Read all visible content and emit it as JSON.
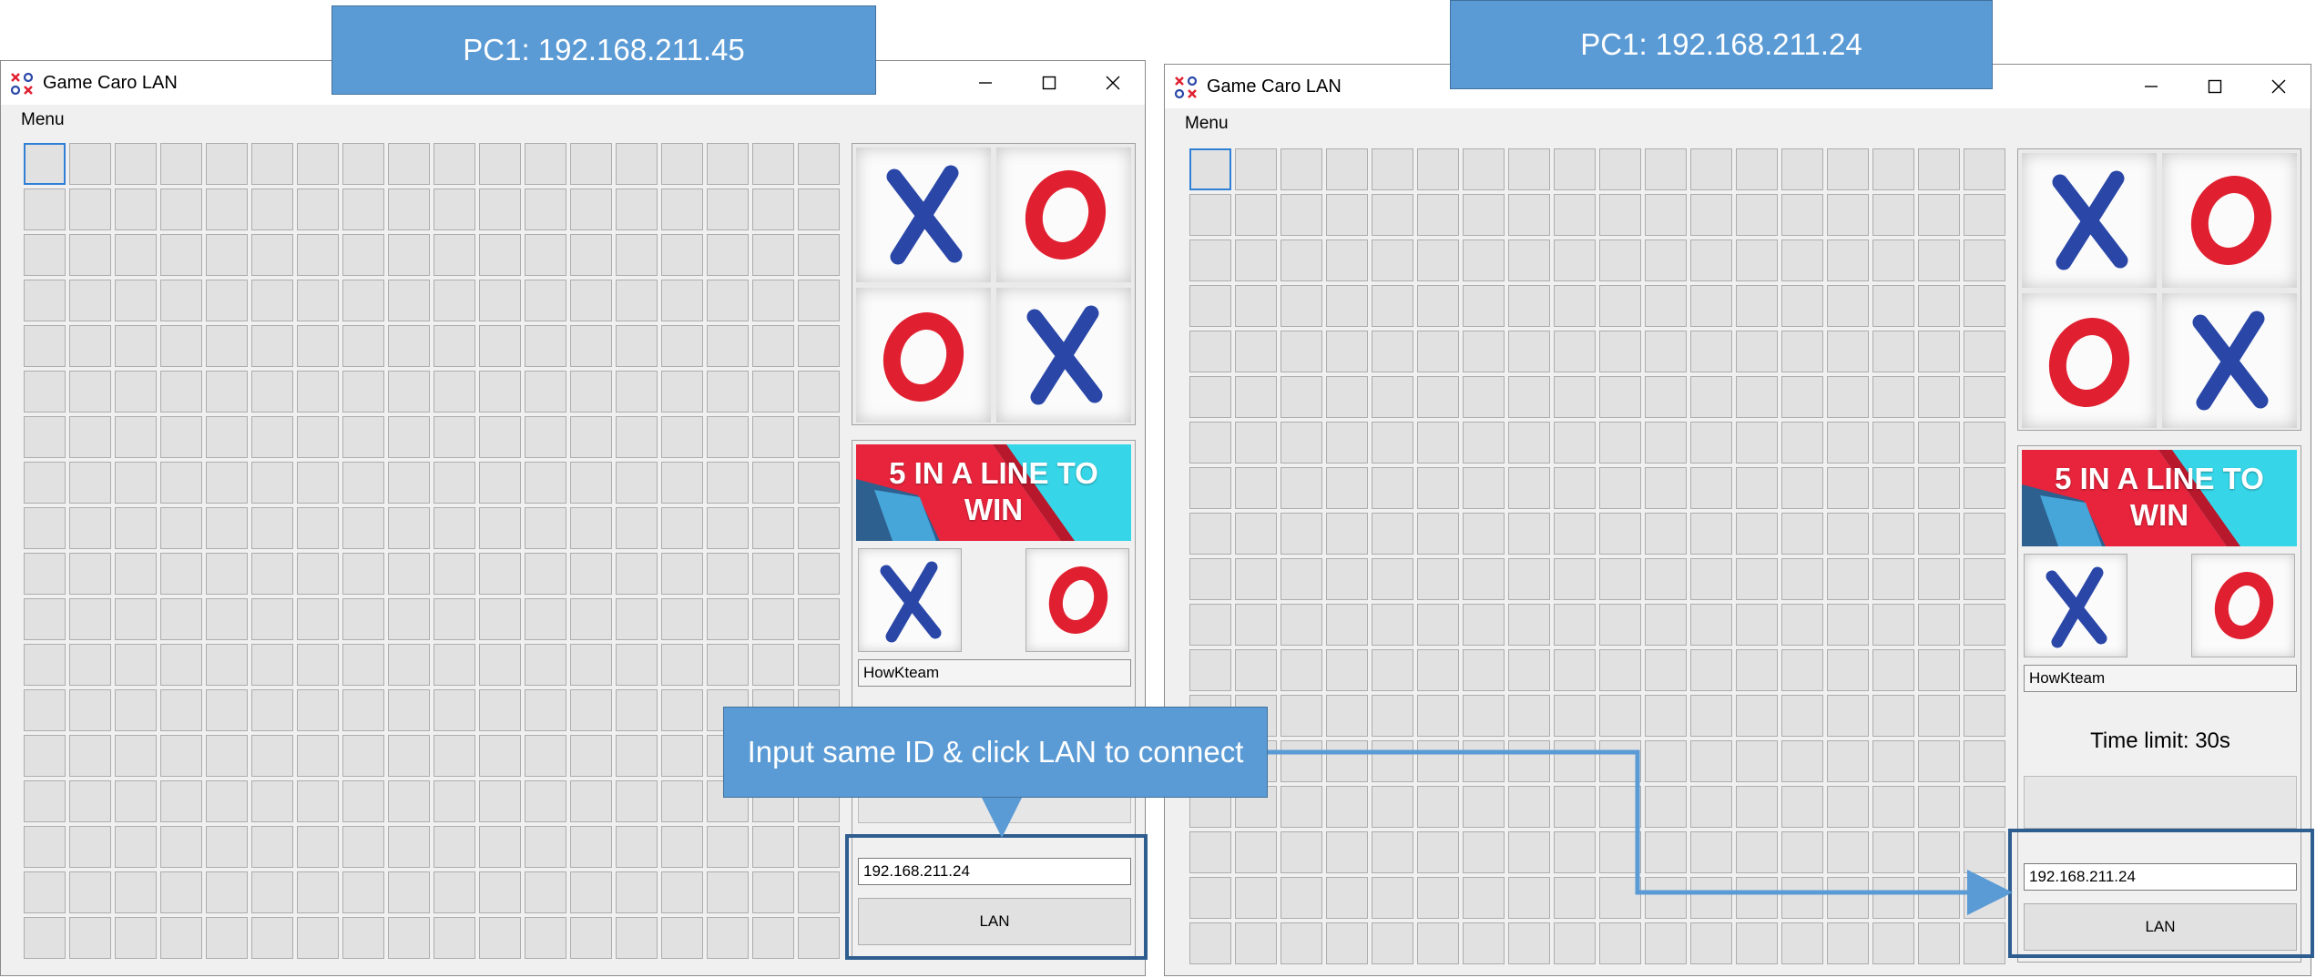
{
  "windows": [
    {
      "title": "Game Caro LAN",
      "menu": "Menu",
      "banner_text": "5 IN A LINE TO WIN",
      "player_name": "HowKteam",
      "timer_label": "",
      "ip_value": "192.168.211.24",
      "lan_label": "LAN"
    },
    {
      "title": "Game Caro LAN",
      "menu": "Menu",
      "banner_text": "5 IN A LINE TO WIN",
      "player_name": "HowKteam",
      "timer_label": "Time limit: 30s",
      "ip_value": "192.168.211.24",
      "lan_label": "LAN"
    }
  ],
  "callouts": {
    "pc_left": "PC1: 192.168.211.45",
    "pc_right": "PC1: 192.168.211.24",
    "instruction": "Input same ID & click LAN to connect"
  },
  "colors": {
    "x_mark": "#2a47a8",
    "o_mark": "#e02030",
    "callout_fill": "#5b9bd5",
    "highlight_border": "#2e5d8f"
  }
}
